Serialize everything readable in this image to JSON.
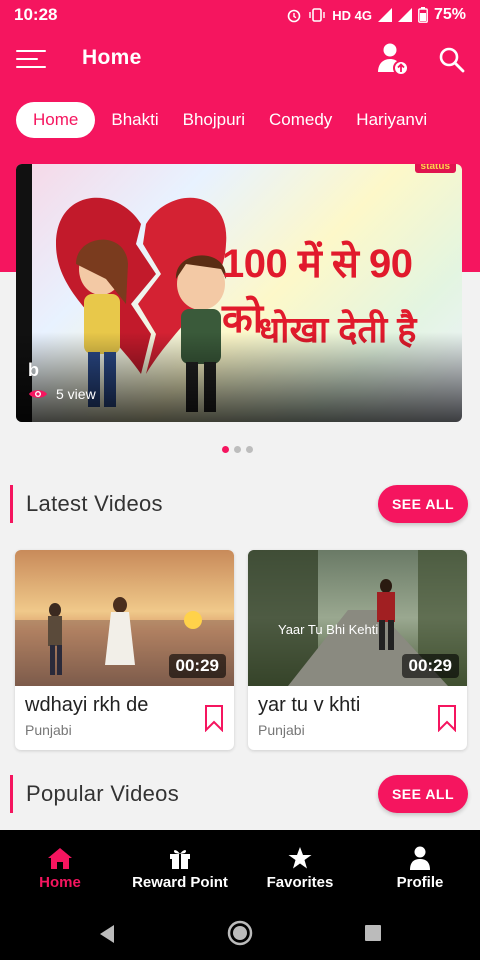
{
  "status_bar": {
    "time": "10:28",
    "network": "HD 4G",
    "battery": "75%"
  },
  "app_bar": {
    "title": "Home"
  },
  "tabs": [
    {
      "label": "Home"
    },
    {
      "label": "Bhakti"
    },
    {
      "label": "Bhojpuri"
    },
    {
      "label": "Comedy"
    },
    {
      "label": "Hariyanvi"
    }
  ],
  "banner": {
    "badge": "status",
    "line1": "100 में से 90 को",
    "line2": "धोखा देती है",
    "title": "b",
    "views": "5 view"
  },
  "latest": {
    "title": "Latest Videos",
    "see_all": "SEE ALL",
    "videos": [
      {
        "title": "wdhayi rkh de",
        "category": "Punjabi",
        "duration": "00:29"
      },
      {
        "title": "yar tu v khti",
        "category": "Punjabi",
        "duration": "00:29",
        "overlay": "Yaar Tu Bhi Kehti"
      }
    ]
  },
  "popular": {
    "title": "Popular Videos",
    "see_all": "SEE ALL"
  },
  "bottom_nav": [
    {
      "label": "Home",
      "icon": "home-icon"
    },
    {
      "label": "Reward Point",
      "icon": "gift-icon"
    },
    {
      "label": "Favorites",
      "icon": "star-icon"
    },
    {
      "label": "Profile",
      "icon": "person-icon"
    }
  ],
  "colors": {
    "accent": "#f5155f",
    "nav_bg": "#000000"
  }
}
